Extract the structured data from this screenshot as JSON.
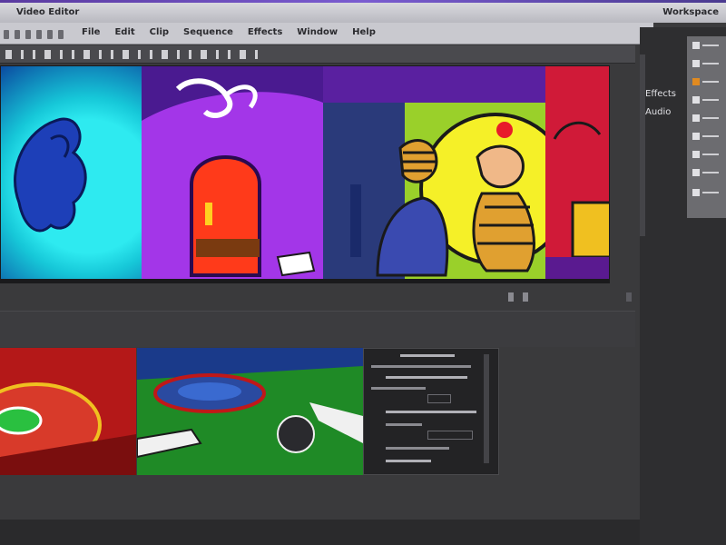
{
  "window": {
    "title": "Video Editor",
    "right_label": "Workspace"
  },
  "menu": {
    "items": [
      "File",
      "Edit",
      "Clip",
      "Sequence",
      "Effects",
      "Window",
      "Help"
    ]
  },
  "right_panel": {
    "labels": [
      "Effects",
      "Audio"
    ]
  },
  "colors": {
    "accent": "#6a4cc0",
    "panel": "#2e2e30",
    "chrome": "#c9c9cf"
  }
}
